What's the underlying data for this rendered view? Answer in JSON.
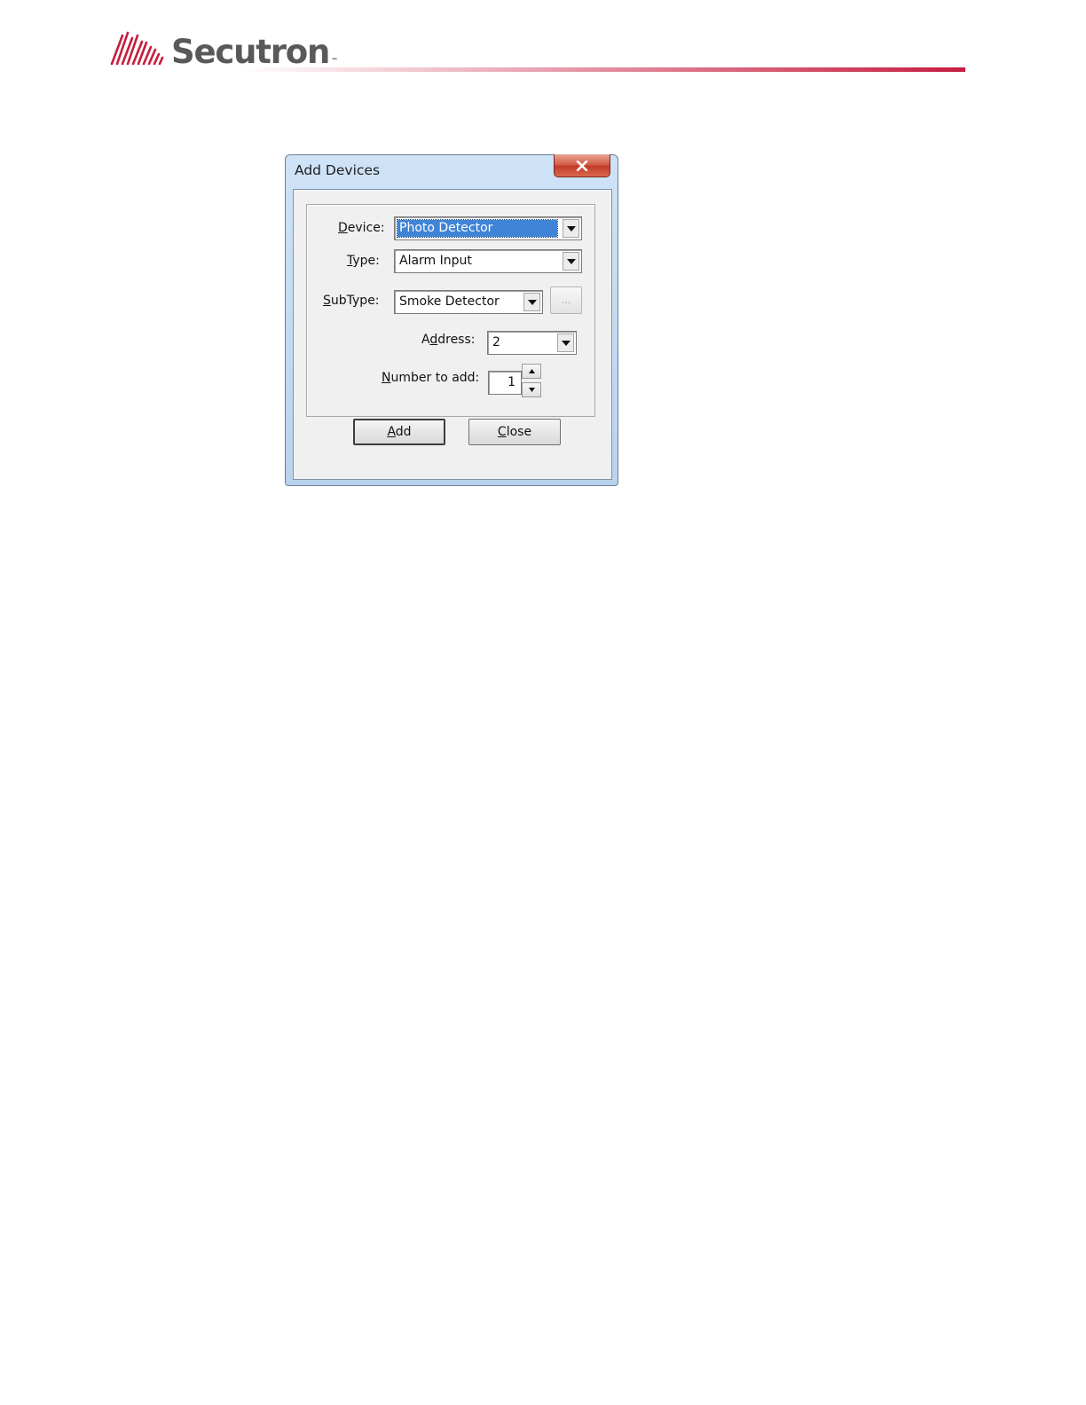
{
  "brand": {
    "name": "Secutron",
    "trademark": "™",
    "accent_color": "#c61d3f",
    "text_color": "#595959"
  },
  "dialog": {
    "title": "Add Devices",
    "close_icon": "close-x-icon",
    "fields": {
      "device": {
        "label_prefix": "",
        "label_mnemonic": "D",
        "label_suffix": "evice:",
        "value": "Photo Detector"
      },
      "type": {
        "label_prefix": "",
        "label_mnemonic": "T",
        "label_suffix": "ype:",
        "value": "Alarm Input"
      },
      "subtype": {
        "label_prefix": "",
        "label_mnemonic": "S",
        "label_suffix": "ubType:",
        "value": "Smoke Detector",
        "ellipsis_label": "..."
      },
      "address": {
        "label_prefix": "A",
        "label_mnemonic": "d",
        "label_suffix": "dress:",
        "value": "2"
      },
      "number_to_add": {
        "label_prefix": "",
        "label_mnemonic": "N",
        "label_suffix": "umber to add:",
        "value": "1"
      }
    },
    "buttons": {
      "add": {
        "mnemonic": "A",
        "rest": "dd"
      },
      "close": {
        "mnemonic": "C",
        "rest": "lose"
      }
    },
    "selection_color": "#3f84d6"
  }
}
